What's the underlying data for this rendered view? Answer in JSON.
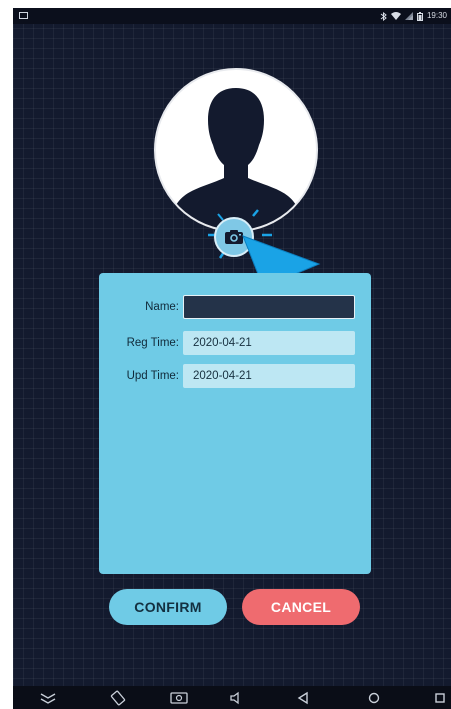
{
  "statusbar": {
    "time": "19:30",
    "icons": [
      "bluetooth-icon",
      "wifi-icon",
      "signal-icon",
      "battery-icon"
    ]
  },
  "form": {
    "name_label": "Name:",
    "name_value": "",
    "reg_time_label": "Reg Time:",
    "reg_time_value": "2020-04-21",
    "upd_time_label": "Upd Time:",
    "upd_time_value": "2020-04-21"
  },
  "actions": {
    "confirm_label": "CONFIRM",
    "cancel_label": "CANCEL"
  },
  "navbar": {
    "items": [
      "collapse-icon",
      "rotate-icon",
      "screenshot-icon",
      "volume-icon",
      "back-icon",
      "home-icon",
      "recents-icon"
    ]
  },
  "colors": {
    "background": "#131a2e",
    "card": "#6fcbe6",
    "field": "#bde7f3",
    "confirm": "#6fcbe6",
    "cancel": "#ef6b6f",
    "pointer": "#1aa3e6"
  }
}
